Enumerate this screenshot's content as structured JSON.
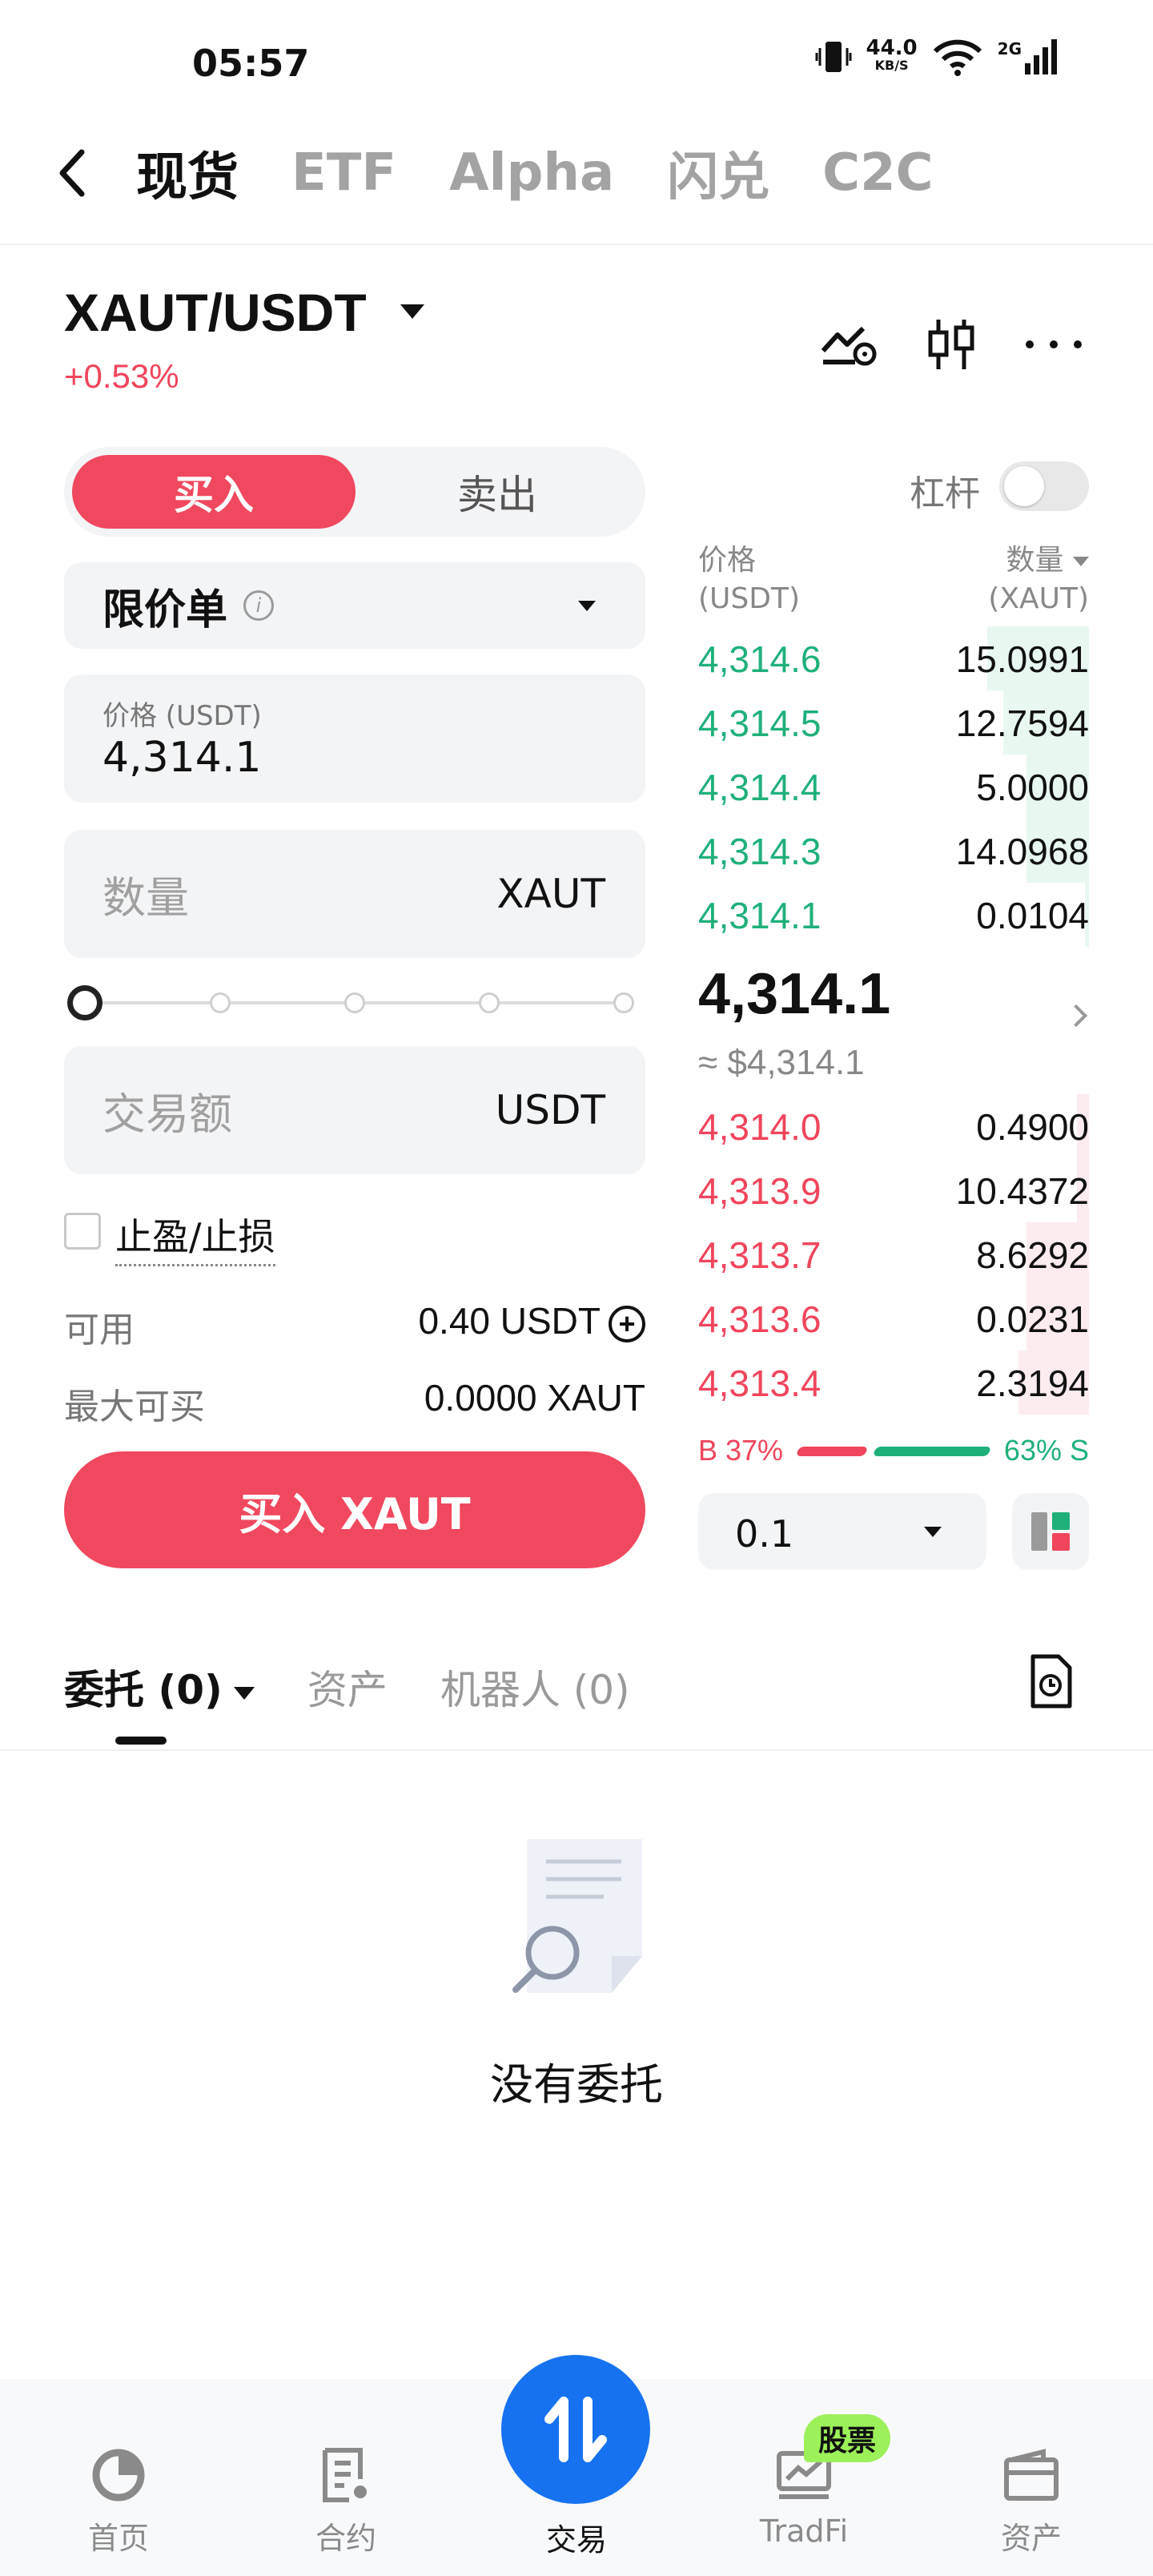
{
  "status": {
    "time": "05:57",
    "speed_value": "44.0",
    "speed_unit": "KB/S",
    "network": "2G"
  },
  "top_tabs": [
    "现货",
    "ETF",
    "Alpha",
    "闪兑",
    "C2C"
  ],
  "pair": {
    "name": "XAUT/USDT",
    "change": "+0.53%"
  },
  "trade_form": {
    "buy_label": "买入",
    "sell_label": "卖出",
    "order_type": "限价单",
    "price_label": "价格 (USDT)",
    "price_value": "4,314.1",
    "qty_placeholder": "数量",
    "qty_unit": "XAUT",
    "amount_placeholder": "交易额",
    "amount_unit": "USDT",
    "tpsl_label": "止盈/止损",
    "available_label": "可用",
    "available_value": "0.40 USDT",
    "max_buy_label": "最大可买",
    "max_buy_value": "0.0000 XAUT",
    "submit_label": "买入 XAUT"
  },
  "order_book": {
    "leverage_label": "杠杆",
    "price_header": "价格",
    "price_header_unit": "(USDT)",
    "qty_header": "数量",
    "qty_header_unit": "(XAUT)",
    "bids": [
      {
        "price": "4,314.6",
        "qty": "15.0991",
        "depth": 0.26
      },
      {
        "price": "4,314.5",
        "qty": "12.7594",
        "depth": 0.22
      },
      {
        "price": "4,314.4",
        "qty": "5.0000",
        "depth": 0.16
      },
      {
        "price": "4,314.3",
        "qty": "14.0968",
        "depth": 0.16
      },
      {
        "price": "4,314.1",
        "qty": "0.0104",
        "depth": 0.01
      }
    ],
    "last_price": "4,314.1",
    "last_fiat": "≈ $4,314.1",
    "asks": [
      {
        "price": "4,314.0",
        "qty": "0.4900",
        "depth": 0.03
      },
      {
        "price": "4,313.9",
        "qty": "10.4372",
        "depth": 0.03
      },
      {
        "price": "4,313.7",
        "qty": "8.6292",
        "depth": 0.16
      },
      {
        "price": "4,313.6",
        "qty": "0.0231",
        "depth": 0.16
      },
      {
        "price": "4,313.4",
        "qty": "2.3194",
        "depth": 0.18
      }
    ],
    "buy_ratio": "B 37%",
    "sell_ratio": "63% S",
    "depth_step": "0.1"
  },
  "orders": {
    "tabs": [
      "委托 (0)",
      "资产",
      "机器人 (0)"
    ],
    "empty_text": "没有委托"
  },
  "bottom_nav": {
    "items": [
      "首页",
      "合约",
      "交易",
      "TradFi",
      "资产"
    ],
    "badge": "股票"
  },
  "colors": {
    "buy_red": "#f0485f",
    "sell_green": "#1fb07a",
    "fab_blue": "#1672f0"
  }
}
